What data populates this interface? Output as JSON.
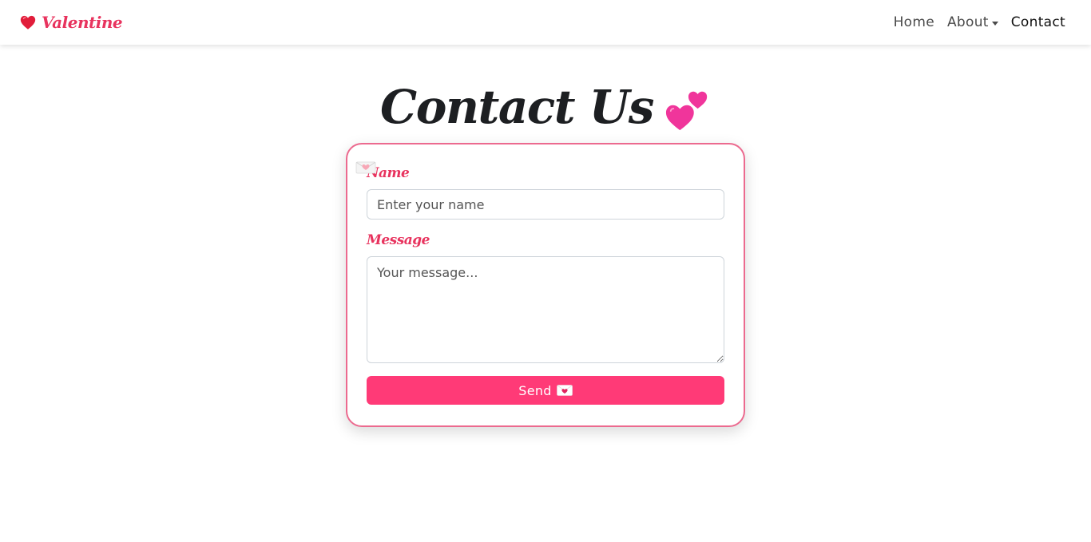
{
  "navbar": {
    "brand_label": "Valentine",
    "brand_icon": "red-heart-icon",
    "links": [
      {
        "label": "Home"
      },
      {
        "label": "About",
        "dropdown": true
      },
      {
        "label": "Contact",
        "active": true
      }
    ]
  },
  "page": {
    "title": "Contact Us",
    "title_icon": "two-hearts-icon"
  },
  "form": {
    "name_label": "Name",
    "name_placeholder": "Enter your name",
    "name_value": "",
    "message_label": "Message",
    "message_placeholder": "Your message...",
    "message_value": "",
    "submit_label": "Send",
    "submit_icon": "love-letter-icon",
    "decor_icon": "love-letter-icon"
  },
  "colors": {
    "brand": "#e8335e",
    "button": "#ff3a77",
    "card_border": "#ec6a8f"
  }
}
